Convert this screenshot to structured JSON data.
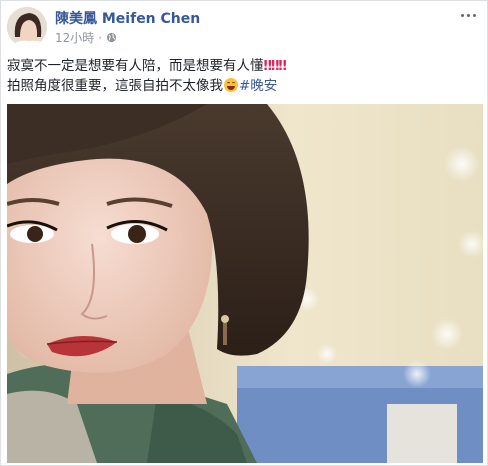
{
  "post": {
    "author": "陳美鳳 Meifen Chen",
    "timestamp": "12小時",
    "separator": "·",
    "text_line1": "寂寞不一定是想要有人陪，而是想要有人懂",
    "text_line1_trail": "‼‼‼",
    "text_line2": "拍照角度很重要，這張自拍不太像我",
    "hashtag": "#晚安"
  },
  "icons": {
    "privacy": "globe-icon",
    "options": "more-options-icon",
    "emoji": "grinning-squinting-face-emoji"
  },
  "colors": {
    "name_link": "#365899",
    "meta_text": "#90949c",
    "body_text": "#1d2129",
    "exclamation": "#e0245e"
  }
}
